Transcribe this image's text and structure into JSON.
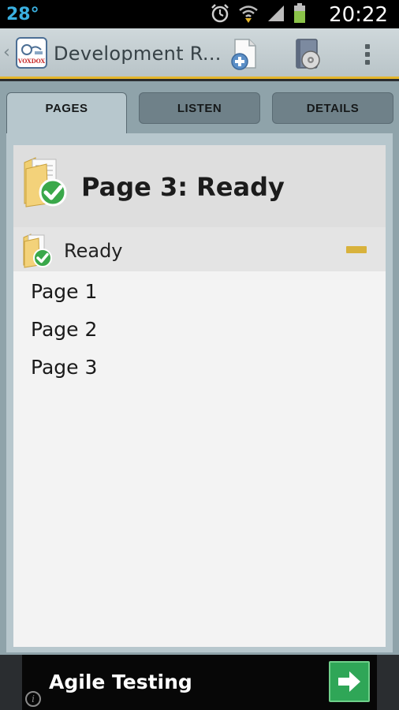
{
  "status_bar": {
    "temperature": "28°",
    "time": "20:22",
    "icons": [
      "alarm-icon",
      "wifi-icon",
      "signal-icon",
      "battery-icon"
    ]
  },
  "action_bar": {
    "title": "Development R...",
    "logo_text": "VOXDOX",
    "icons": [
      "back-chevron-icon",
      "add-page-icon",
      "audio-book-icon",
      "overflow-menu-icon"
    ]
  },
  "tabs": [
    {
      "label": "PAGES",
      "active": true
    },
    {
      "label": "LISTEN",
      "active": false
    },
    {
      "label": "DETAILS",
      "active": false
    }
  ],
  "page_header": {
    "title": "Page 3: Ready"
  },
  "group": {
    "label": "Ready",
    "expanded": true
  },
  "pages": [
    "Page 1",
    "Page 2",
    "Page 3"
  ],
  "ad": {
    "text": "Agile Testing"
  },
  "colors": {
    "accent": "#e5b62b",
    "status_temp": "#3ab0e0",
    "ad_button": "#2fa657"
  }
}
